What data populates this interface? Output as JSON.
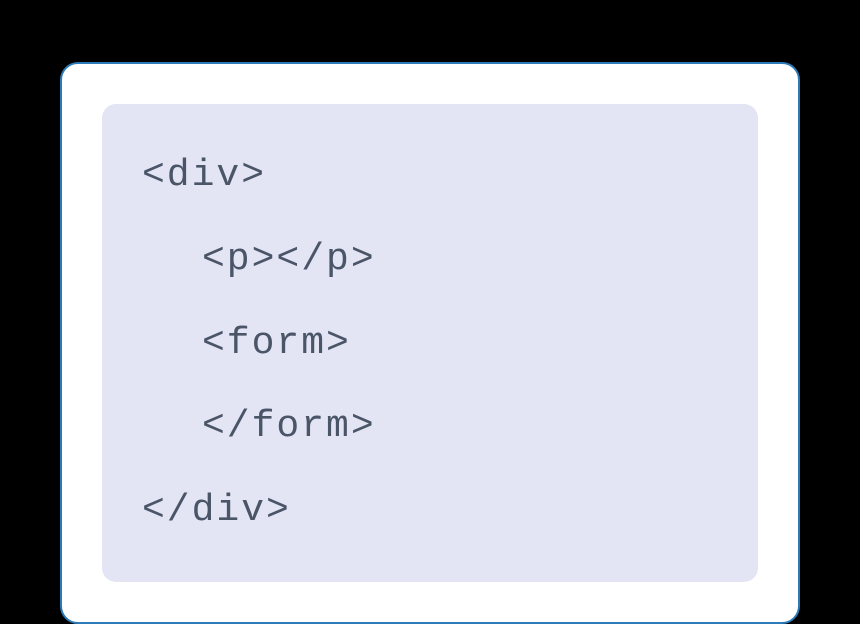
{
  "code": {
    "lines": [
      {
        "text": "<div>",
        "indent": false
      },
      {
        "text": "<p></p>",
        "indent": true
      },
      {
        "text": "<form>",
        "indent": true
      },
      {
        "text": "</form>",
        "indent": true
      },
      {
        "text": "</div>",
        "indent": false
      }
    ]
  }
}
